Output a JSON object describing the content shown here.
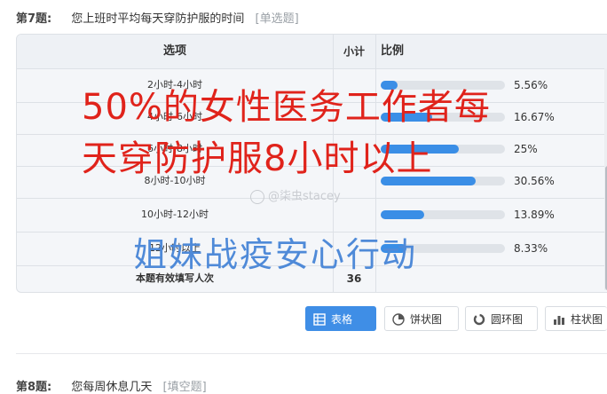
{
  "question7": {
    "number": "第7题:",
    "text": "您上班时平均每天穿防护服的时间",
    "type": "[单选题]"
  },
  "table": {
    "headers": {
      "option": "选项",
      "count": "小计",
      "ratio": "比例"
    },
    "rows": [
      {
        "option": "2小时-4小时",
        "percent_label": "5.56%",
        "fraction": 0.0556
      },
      {
        "option": "4小时-6小时",
        "percent_label": "16.67%",
        "fraction": 0.1667
      },
      {
        "option": "6小时-8小时",
        "percent_label": "25%",
        "fraction": 0.25
      },
      {
        "option": "8小时-10小时",
        "percent_label": "30.56%",
        "fraction": 0.3056
      },
      {
        "option": "10小时-12小时",
        "percent_label": "13.89%",
        "fraction": 0.1389
      },
      {
        "option": "12小时以上",
        "percent_label": "8.33%",
        "fraction": 0.0833
      }
    ],
    "footer": {
      "label": "本题有效填写人次",
      "count": "36"
    }
  },
  "overlay": {
    "line1": "50%的女性医务工作者每",
    "line2": "天穿防护服8小时以上",
    "line3": "姐妹战疫安心行动",
    "watermark": "@柒虫stacey"
  },
  "view_buttons": [
    {
      "label": "表格",
      "icon": "table-icon",
      "active": true
    },
    {
      "label": "饼状图",
      "icon": "pie-chart-icon",
      "active": false
    },
    {
      "label": "圆环图",
      "icon": "ring-chart-icon",
      "active": false
    },
    {
      "label": "柱状图",
      "icon": "bar-chart-icon",
      "active": false
    }
  ],
  "question8": {
    "number": "第8题:",
    "text": "您每周休息几天",
    "type": "[填空题]"
  },
  "colors": {
    "bar_fill": "#3a8ee6",
    "bar_track": "#dfe3e8",
    "overlay_red": "#e0231b",
    "overlay_blue": "#4f8ad8",
    "active_button": "#3f8ee6"
  }
}
